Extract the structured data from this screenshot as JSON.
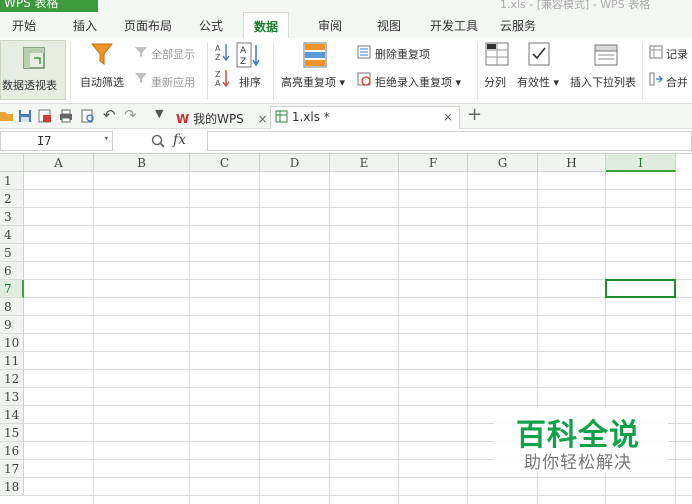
{
  "window": {
    "app_name": "WPS 表格",
    "title_text": "1.xls - [兼容模式] - WPS 表格"
  },
  "menu": {
    "tabs": [
      "开始",
      "插入",
      "页面布局",
      "公式",
      "数据",
      "审阅",
      "视图",
      "开发工具",
      "云服务"
    ],
    "active": "数据"
  },
  "ribbon": {
    "pivot_table": "数据透视表",
    "auto_filter": "自动筛选",
    "show_all": "全部显示",
    "reapply": "重新应用",
    "sort": "排序",
    "highlight_duplicates": "高亮重复项",
    "remove_duplicates": "删除重复项",
    "reject_duplicates": "拒绝录入重复项",
    "text_to_columns": "分列",
    "validity": "有效性",
    "insert_dropdown": "插入下拉列表",
    "record": "记录",
    "merge": "合并"
  },
  "quickbar": {
    "doc_tabs": [
      {
        "label": "我的WPS",
        "active": false
      },
      {
        "label": "1.xls *",
        "active": true
      }
    ],
    "close_glyph": "×",
    "new_tab_glyph": "+"
  },
  "formula_bar": {
    "cell_name": "I7",
    "formula_value": ""
  },
  "sheet": {
    "columns": [
      "A",
      "B",
      "C",
      "D",
      "E",
      "F",
      "G",
      "H",
      "I"
    ],
    "rows": [
      "1",
      "2",
      "3",
      "4",
      "5",
      "6",
      "7",
      "8",
      "9",
      "10",
      "11",
      "12",
      "13",
      "14",
      "15",
      "16",
      "17",
      "18"
    ],
    "active_column": "I",
    "active_row": "7"
  },
  "watermark": {
    "title": "百科全说",
    "subtitle": "助你轻松解决"
  },
  "colors": {
    "accent": "#1a7f2f",
    "active_cell_border": "#1f8b2c",
    "watermark_green": "#12a14a"
  }
}
